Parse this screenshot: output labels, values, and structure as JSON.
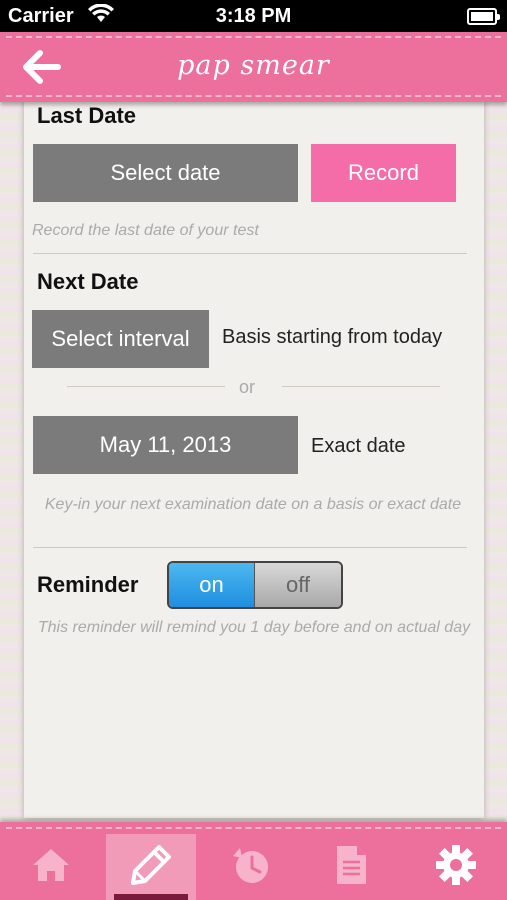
{
  "status_bar": {
    "carrier": "Carrier",
    "time": "3:18 PM"
  },
  "header": {
    "title": "pap smear"
  },
  "last_date": {
    "heading": "Last Date",
    "select_label": "Select date",
    "record_label": "Record",
    "hint": "Record the last date of your test"
  },
  "next_date": {
    "heading": "Next Date",
    "interval_label": "Select interval",
    "interval_caption": "Basis starting from today",
    "or_label": "or",
    "date_value": "May 11, 2013",
    "date_caption": "Exact date",
    "hint": "Key-in your next examination date on a basis or exact date"
  },
  "reminder": {
    "heading": "Reminder",
    "on_label": "on",
    "off_label": "off",
    "state": "on",
    "hint": "This reminder will remind you 1 day before and on actual day"
  },
  "tabs": [
    {
      "icon": "home-icon"
    },
    {
      "icon": "pencil-icon",
      "active": true
    },
    {
      "icon": "clock-icon"
    },
    {
      "icon": "document-icon"
    },
    {
      "icon": "gear-icon"
    }
  ],
  "colors": {
    "header": "#ec6f9c",
    "record": "#f46da8",
    "toggle_on": "#1f8ee0"
  }
}
